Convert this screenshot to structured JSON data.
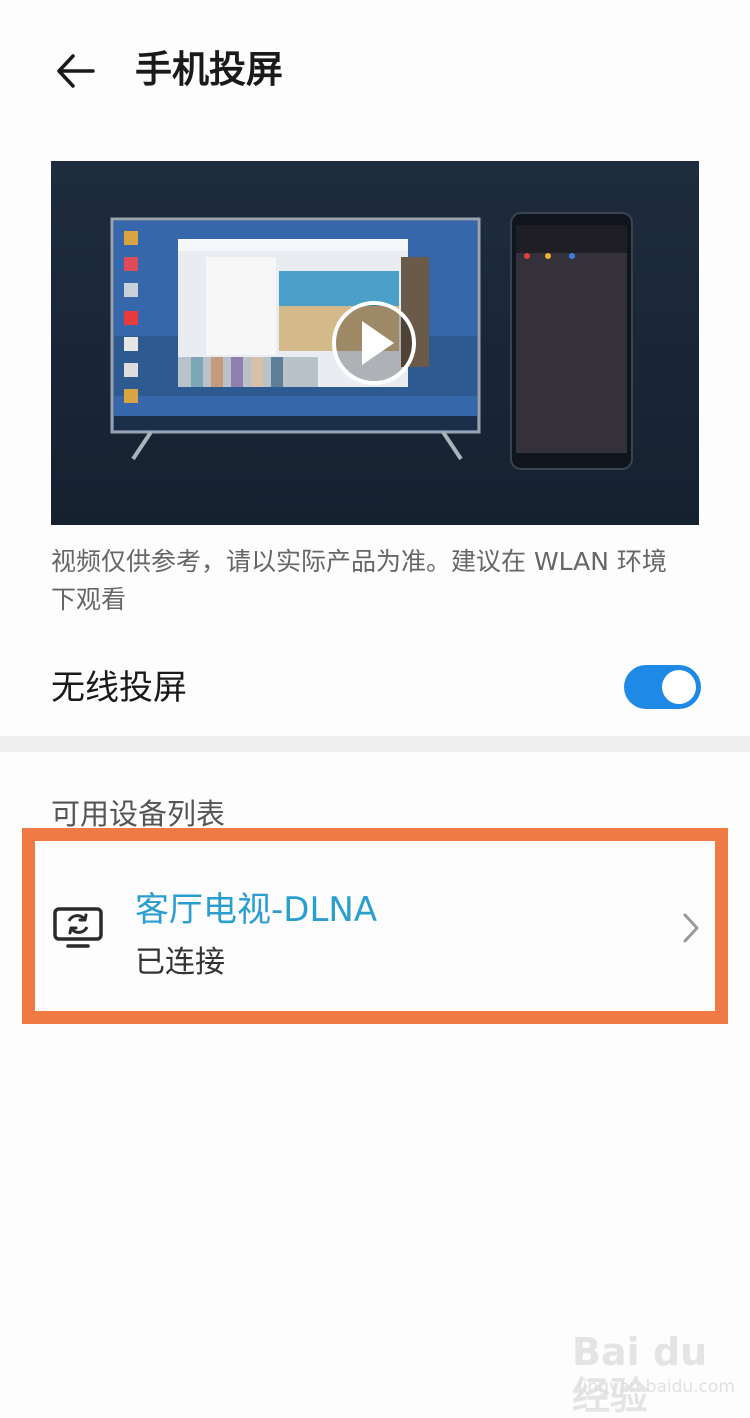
{
  "header": {
    "title": "手机投屏"
  },
  "media": {
    "play_icon": "play-icon"
  },
  "caption": "视频仅供参考，请以实际产品为准。建议在 WLAN 环境下观看",
  "wireless_projection": {
    "label": "无线投屏",
    "enabled": true,
    "accent": "#1f8ae5"
  },
  "devices": {
    "section_title": "可用设备列表",
    "items": [
      {
        "name": "客厅电视-DLNA",
        "status": "已连接",
        "icon": "tv-cast-icon",
        "name_color": "#2a9fcf"
      }
    ],
    "highlight_color": "#f07a44"
  },
  "watermark": {
    "brand": "Bai du 经验",
    "url": "jingyan.baidu.com"
  }
}
